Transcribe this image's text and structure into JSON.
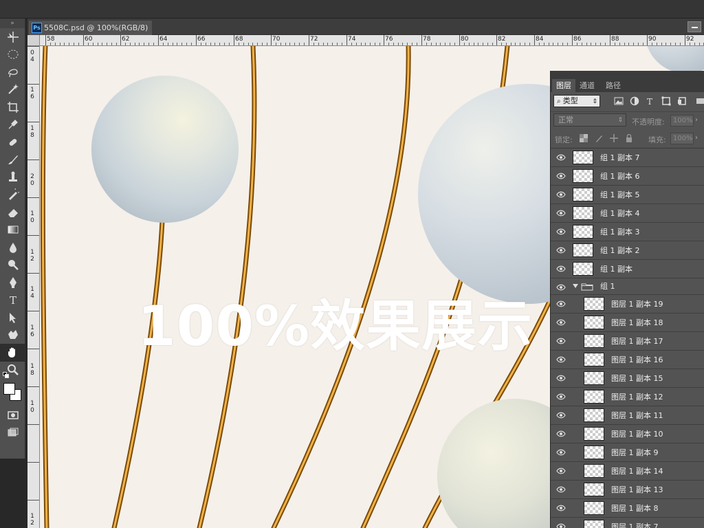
{
  "document": {
    "tab_title": "5508C.psd @ 100%(RGB/8)",
    "app_badge": "Ps",
    "zoom": "100%",
    "color_mode": "RGB/8"
  },
  "ruler_top": {
    "labels": [
      "58",
      "60",
      "62",
      "64",
      "66",
      "68",
      "70",
      "72",
      "74",
      "76",
      "78",
      "80",
      "82",
      "84",
      "86",
      "88",
      "90",
      "92"
    ]
  },
  "ruler_left": {
    "labels": [
      "0",
      "4",
      "1",
      "6",
      "1",
      "8",
      "2",
      "0",
      "1",
      "0",
      "1",
      "2",
      "1",
      "4",
      "1",
      "6",
      "1",
      "8",
      "1",
      "0",
      "1",
      "2"
    ]
  },
  "toolbox": {
    "tools": [
      "move-tool",
      "marquee-tool",
      "lasso-tool",
      "magic-wand-tool",
      "crop-tool",
      "eyedropper-tool",
      "healing-brush-tool",
      "brush-tool",
      "clone-stamp-tool",
      "history-brush-tool",
      "eraser-tool",
      "gradient-tool",
      "blur-tool",
      "dodge-tool",
      "pen-tool",
      "type-tool",
      "path-selection-tool",
      "shape-tool",
      "hand-tool",
      "zoom-tool"
    ],
    "active_tool": "hand-tool",
    "foreground_color": "#ffffff",
    "background_color": "#ffffff"
  },
  "overlay": {
    "text": "100%效果展示"
  },
  "layers_panel": {
    "tabs": [
      "图层",
      "通道",
      "路径"
    ],
    "active_tab": "图层",
    "filter_label": "类型",
    "filter_icons": [
      "image-filter-icon",
      "adjustment-filter-icon",
      "type-filter-icon",
      "shape-filter-icon",
      "smart-object-filter-icon"
    ],
    "blend_mode": "正常",
    "opacity_label": "不透明度:",
    "opacity_value": "100%",
    "lock_label": "锁定:",
    "fill_label": "填充:",
    "fill_value": "100%",
    "layers": [
      {
        "name": "组 1 副本 7",
        "kind": "group-copy",
        "level": 0
      },
      {
        "name": "组 1 副本 6",
        "kind": "group-copy",
        "level": 0
      },
      {
        "name": "组 1 副本 5",
        "kind": "group-copy",
        "level": 0
      },
      {
        "name": "组 1 副本 4",
        "kind": "group-copy",
        "level": 0
      },
      {
        "name": "组 1 副本 3",
        "kind": "group-copy",
        "level": 0
      },
      {
        "name": "组 1 副本 2",
        "kind": "group-copy",
        "level": 0
      },
      {
        "name": "组 1 副本",
        "kind": "group-copy",
        "level": 0
      },
      {
        "name": "组 1",
        "kind": "group",
        "level": 0
      },
      {
        "name": "图层 1 副本 19",
        "kind": "layer",
        "level": 1
      },
      {
        "name": "图层 1 副本 18",
        "kind": "layer",
        "level": 1
      },
      {
        "name": "图层 1 副本 17",
        "kind": "layer",
        "level": 1
      },
      {
        "name": "图层 1 副本 16",
        "kind": "layer",
        "level": 1
      },
      {
        "name": "图层 1 副本 15",
        "kind": "layer",
        "level": 1
      },
      {
        "name": "图层 1 副本 12",
        "kind": "layer",
        "level": 1
      },
      {
        "name": "图层 1 副本 11",
        "kind": "layer",
        "level": 1
      },
      {
        "name": "图层 1 副本 10",
        "kind": "layer",
        "level": 1
      },
      {
        "name": "图层 1 副本 9",
        "kind": "layer",
        "level": 1
      },
      {
        "name": "图层 1 副本 14",
        "kind": "layer",
        "level": 1
      },
      {
        "name": "图层 1 副本 13",
        "kind": "layer",
        "level": 1
      },
      {
        "name": "图层 1 副本 8",
        "kind": "layer",
        "level": 1
      },
      {
        "name": "图层 1 副本 7",
        "kind": "layer",
        "level": 1
      }
    ]
  },
  "colors": {
    "canvas_bg": "#f5f0ea",
    "gold": "#c98a1e",
    "pearl": "#e8ece8",
    "panel_bg": "#535353"
  }
}
